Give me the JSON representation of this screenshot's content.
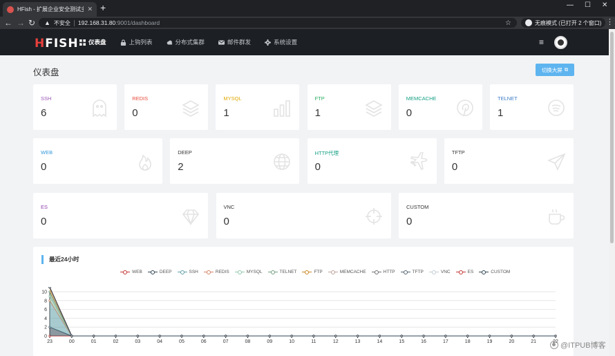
{
  "browser": {
    "tab_title": "HFish - 扩展企业安全测试主动诱",
    "not_secure": "不安全",
    "url_host": "192.168.31.80",
    "url_rest": ":9001/dashboard",
    "incognito_label": "无痕模式 (已打开 2 个窗口)"
  },
  "app": {
    "logo_first": "H",
    "logo_rest": "FISH",
    "nav": [
      {
        "label": "仪表盘",
        "icon": "dashboard-icon",
        "active": true
      },
      {
        "label": "上钩列表",
        "icon": "lock-icon",
        "active": false
      },
      {
        "label": "分布式集群",
        "icon": "cloud-icon",
        "active": false
      },
      {
        "label": "邮件群发",
        "icon": "mail-icon",
        "active": false
      },
      {
        "label": "系统设置",
        "icon": "gear-icon",
        "active": false
      }
    ]
  },
  "page": {
    "title": "仪表盘",
    "switch_button": "切换大屏"
  },
  "cards": [
    {
      "label": "SSH",
      "value": "6",
      "color": "#9b59b6",
      "icon": "ghost-icon"
    },
    {
      "label": "REDIS",
      "value": "0",
      "color": "#e74c3c",
      "icon": "layers-icon"
    },
    {
      "label": "MYSQL",
      "value": "1",
      "color": "#e0a800",
      "icon": "bar-chart-icon"
    },
    {
      "label": "FTP",
      "value": "1",
      "color": "#27ae60",
      "icon": "layers-icon"
    },
    {
      "label": "MEMCACHE",
      "value": "0",
      "color": "#16a085",
      "icon": "pinterest-icon"
    },
    {
      "label": "TELNET",
      "value": "1",
      "color": "#3f7ec7",
      "icon": "spotify-icon"
    },
    {
      "label": "WEB",
      "value": "0",
      "color": "#3498db",
      "icon": "fire-icon"
    },
    {
      "label": "DEEP",
      "value": "2",
      "color": "#333333",
      "icon": "globe-icon"
    },
    {
      "label": "HTTP代理",
      "value": "0",
      "color": "#16a085",
      "icon": "plane-icon"
    },
    {
      "label": "TFTP",
      "value": "0",
      "color": "#333333",
      "icon": "send-icon"
    },
    {
      "label": "ES",
      "value": "0",
      "color": "#8e44ad",
      "icon": "diamond-icon"
    },
    {
      "label": "VNC",
      "value": "0",
      "color": "#333333",
      "icon": "crosshair-icon"
    },
    {
      "label": "CUSTOM",
      "value": "0",
      "color": "#333333",
      "icon": "coffee-icon"
    }
  ],
  "chart_data": {
    "type": "line",
    "title": "最近24小时",
    "x": [
      "23",
      "00",
      "01",
      "02",
      "03",
      "04",
      "05",
      "06",
      "07",
      "08",
      "09",
      "10",
      "11",
      "12",
      "13",
      "14",
      "15",
      "16",
      "17",
      "18",
      "19",
      "20",
      "21",
      "22"
    ],
    "ylim": [
      0,
      10
    ],
    "yticks": [
      0,
      2,
      4,
      6,
      8,
      10
    ],
    "grid": true,
    "legend_position": "top",
    "series": [
      {
        "name": "WEB",
        "color": "#c23531",
        "values": [
          0,
          0,
          0,
          0,
          0,
          0,
          0,
          0,
          0,
          0,
          0,
          0,
          0,
          0,
          0,
          0,
          0,
          0,
          0,
          0,
          0,
          0,
          0,
          0
        ]
      },
      {
        "name": "DEEP",
        "color": "#2f4554",
        "values": [
          2,
          0,
          0,
          0,
          0,
          0,
          0,
          0,
          0,
          0,
          0,
          0,
          0,
          0,
          0,
          0,
          0,
          0,
          0,
          0,
          0,
          0,
          0,
          0
        ]
      },
      {
        "name": "SSH",
        "color": "#61a0a8",
        "values": [
          6,
          0,
          0,
          0,
          0,
          0,
          0,
          0,
          0,
          0,
          0,
          0,
          0,
          0,
          0,
          0,
          0,
          0,
          0,
          0,
          0,
          0,
          0,
          0
        ]
      },
      {
        "name": "REDIS",
        "color": "#d48265",
        "values": [
          0,
          0,
          0,
          0,
          0,
          0,
          0,
          0,
          0,
          0,
          0,
          0,
          0,
          0,
          0,
          0,
          0,
          0,
          0,
          0,
          0,
          0,
          0,
          0
        ]
      },
      {
        "name": "MYSQL",
        "color": "#91c7ae",
        "values": [
          1,
          0,
          0,
          0,
          0,
          0,
          0,
          0,
          0,
          0,
          0,
          0,
          0,
          0,
          0,
          0,
          0,
          0,
          0,
          0,
          0,
          0,
          0,
          0
        ]
      },
      {
        "name": "TELNET",
        "color": "#749f83",
        "values": [
          1,
          0,
          0,
          0,
          0,
          0,
          0,
          0,
          0,
          0,
          0,
          0,
          0,
          0,
          0,
          0,
          0,
          0,
          0,
          0,
          0,
          0,
          0,
          0
        ]
      },
      {
        "name": "FTP",
        "color": "#ca8622",
        "values": [
          1,
          0,
          0,
          0,
          0,
          0,
          0,
          0,
          0,
          0,
          0,
          0,
          0,
          0,
          0,
          0,
          0,
          0,
          0,
          0,
          0,
          0,
          0,
          0
        ]
      },
      {
        "name": "MEMCACHE",
        "color": "#bda29a",
        "values": [
          0,
          0,
          0,
          0,
          0,
          0,
          0,
          0,
          0,
          0,
          0,
          0,
          0,
          0,
          0,
          0,
          0,
          0,
          0,
          0,
          0,
          0,
          0,
          0
        ]
      },
      {
        "name": "HTTP",
        "color": "#6e7074",
        "values": [
          0,
          0,
          0,
          0,
          0,
          0,
          0,
          0,
          0,
          0,
          0,
          0,
          0,
          0,
          0,
          0,
          0,
          0,
          0,
          0,
          0,
          0,
          0,
          0
        ]
      },
      {
        "name": "TFTP",
        "color": "#546570",
        "values": [
          0,
          0,
          0,
          0,
          0,
          0,
          0,
          0,
          0,
          0,
          0,
          0,
          0,
          0,
          0,
          0,
          0,
          0,
          0,
          0,
          0,
          0,
          0,
          0
        ]
      },
      {
        "name": "VNC",
        "color": "#c4ccd3",
        "values": [
          0,
          0,
          0,
          0,
          0,
          0,
          0,
          0,
          0,
          0,
          0,
          0,
          0,
          0,
          0,
          0,
          0,
          0,
          0,
          0,
          0,
          0,
          0,
          0
        ]
      },
      {
        "name": "ES",
        "color": "#c23531",
        "values": [
          0,
          0,
          0,
          0,
          0,
          0,
          0,
          0,
          0,
          0,
          0,
          0,
          0,
          0,
          0,
          0,
          0,
          0,
          0,
          0,
          0,
          0,
          0,
          0
        ]
      },
      {
        "name": "CUSTOM",
        "color": "#2f4554",
        "values": [
          0,
          0,
          0,
          0,
          0,
          0,
          0,
          0,
          0,
          0,
          0,
          0,
          0,
          0,
          0,
          0,
          0,
          0,
          0,
          0,
          0,
          0,
          0,
          0
        ]
      }
    ]
  },
  "watermark": "@ITPUB博客"
}
